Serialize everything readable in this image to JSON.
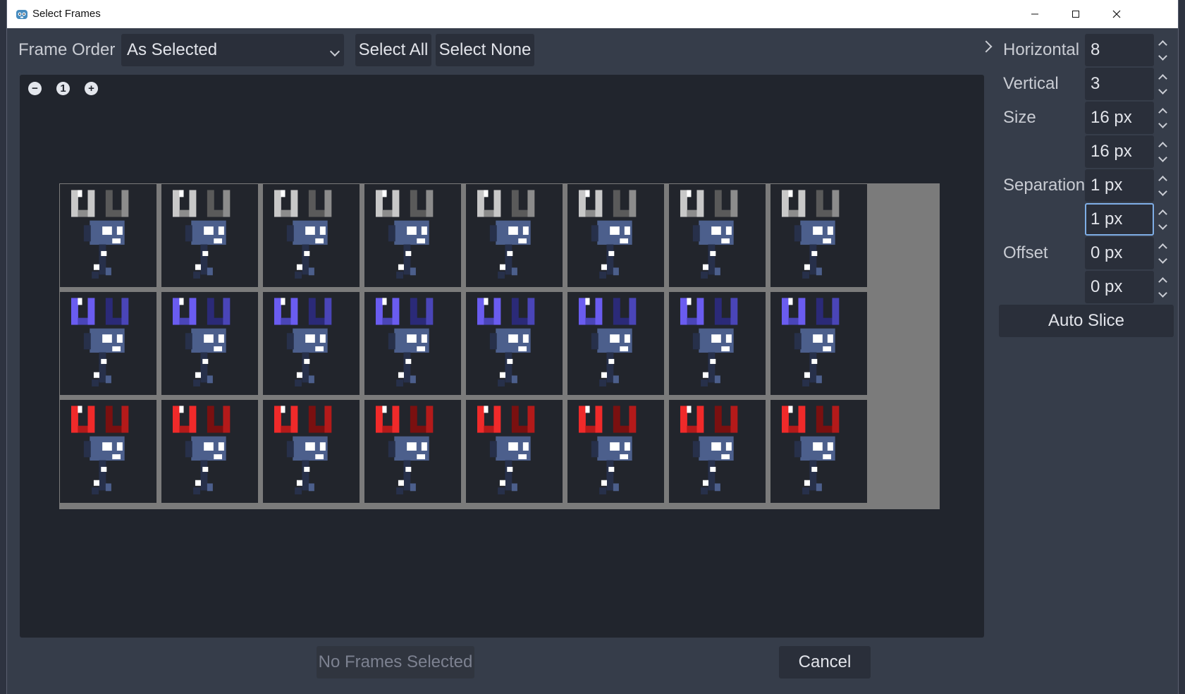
{
  "window": {
    "title": "Select Frames",
    "minimize_icon": "minimize-icon",
    "maximize_icon": "maximize-icon",
    "close_icon": "close-icon"
  },
  "toolbar": {
    "frame_order_label": "Frame Order",
    "frame_order_value": "As Selected",
    "select_all_label": "Select All",
    "select_none_label": "Select None"
  },
  "zoom": {
    "zoom_out_icon": "zoom-out-icon",
    "zoom_reset_label": "1",
    "zoom_in_icon": "zoom-in-icon"
  },
  "spritesheet": {
    "columns": 8,
    "rows": 3,
    "row_colors": [
      {
        "light": "#c8c8c8",
        "dark": "#5a5a5a",
        "mid": "#8c8c8c"
      },
      {
        "light": "#6a5cf0",
        "dark": "#2b2a78",
        "mid": "#4a45b8"
      },
      {
        "light": "#f02a2a",
        "dark": "#7a1010",
        "mid": "#b41a1a"
      }
    ],
    "body_color": "#4c5f8c",
    "body_dark": "#27304a",
    "eye_color": "#ffffff",
    "background_color": "#22252c",
    "separator_color": "#7b7b7b"
  },
  "settings": {
    "horizontal_label": "Horizontal",
    "horizontal_value": "8",
    "vertical_label": "Vertical",
    "vertical_value": "3",
    "size_label": "Size",
    "size_x": "16 px",
    "size_y": "16 px",
    "separation_label": "Separation",
    "separation_x": "1 px",
    "separation_y": "1 px",
    "offset_label": "Offset",
    "offset_x": "0 px",
    "offset_y": "0 px",
    "auto_slice_label": "Auto Slice"
  },
  "footer": {
    "confirm_label": "No Frames Selected",
    "cancel_label": "Cancel"
  }
}
